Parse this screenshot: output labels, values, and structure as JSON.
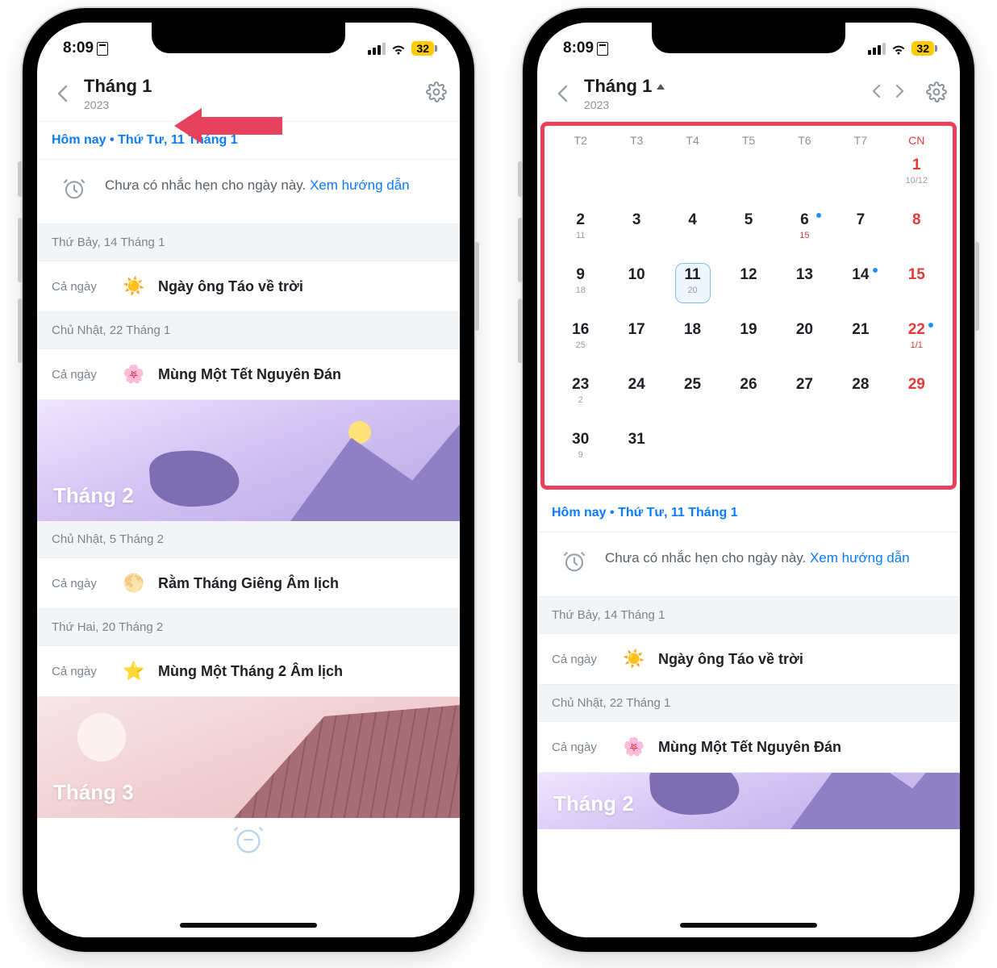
{
  "status": {
    "time": "8:09",
    "battery": "32"
  },
  "header": {
    "title": "Tháng 1",
    "year": "2023"
  },
  "today_bar": "Hôm nay • Thứ Tư, 11 Tháng 1",
  "reminder": {
    "text": "Chưa có nhắc hẹn cho ngày này. ",
    "link": "Xem hướng dẫn"
  },
  "all_day_label": "Cả ngày",
  "left_events": [
    {
      "header": "Thứ Bảy, 14 Tháng 1",
      "icon": "☀️",
      "title": "Ngày ông Táo về trời"
    },
    {
      "header": "Chủ Nhật, 22 Tháng 1",
      "icon": "🌸",
      "title": "Mùng Một Tết Nguyên Đán"
    }
  ],
  "month2_label": "Tháng 2",
  "left_events2": [
    {
      "header": "Chủ Nhật, 5 Tháng 2",
      "icon": "🌕",
      "title": "Rằm Tháng Giêng Âm lịch"
    },
    {
      "header": "Thứ Hai, 20 Tháng 2",
      "icon": "⭐",
      "title": "Mùng Một Tháng 2 Âm lịch"
    }
  ],
  "month3_label": "Tháng 3",
  "weekdays": [
    "T2",
    "T3",
    "T4",
    "T5",
    "T6",
    "T7",
    "CN"
  ],
  "calendar": [
    [
      null,
      null,
      null,
      null,
      null,
      null,
      {
        "d": "1",
        "s": "10/12",
        "sun": true
      }
    ],
    [
      {
        "d": "2",
        "s": "11"
      },
      {
        "d": "3"
      },
      {
        "d": "4"
      },
      {
        "d": "5"
      },
      {
        "d": "6",
        "s": "15",
        "dot": true,
        "sred": true
      },
      {
        "d": "7"
      },
      {
        "d": "8",
        "sun": true
      }
    ],
    [
      {
        "d": "9",
        "s": "18"
      },
      {
        "d": "10"
      },
      {
        "d": "11",
        "s": "20",
        "today": true
      },
      {
        "d": "12"
      },
      {
        "d": "13"
      },
      {
        "d": "14",
        "dot": true
      },
      {
        "d": "15",
        "sun": true
      }
    ],
    [
      {
        "d": "16",
        "s": "25"
      },
      {
        "d": "17"
      },
      {
        "d": "18"
      },
      {
        "d": "19"
      },
      {
        "d": "20"
      },
      {
        "d": "21"
      },
      {
        "d": "22",
        "s": "1/1",
        "sun": true,
        "dot": true,
        "sred": true
      }
    ],
    [
      {
        "d": "23",
        "s": "2"
      },
      {
        "d": "24"
      },
      {
        "d": "25"
      },
      {
        "d": "26"
      },
      {
        "d": "27"
      },
      {
        "d": "28"
      },
      {
        "d": "29",
        "sun": true
      }
    ],
    [
      {
        "d": "30",
        "s": "9"
      },
      {
        "d": "31"
      },
      null,
      null,
      null,
      null,
      null
    ]
  ],
  "right_events": [
    {
      "header": "Thứ Bảy, 14 Tháng 1",
      "icon": "☀️",
      "title": "Ngày ông Táo về trời"
    },
    {
      "header": "Chủ Nhật, 22 Tháng 1",
      "icon": "🌸",
      "title": "Mùng Một Tết Nguyên Đán"
    }
  ]
}
